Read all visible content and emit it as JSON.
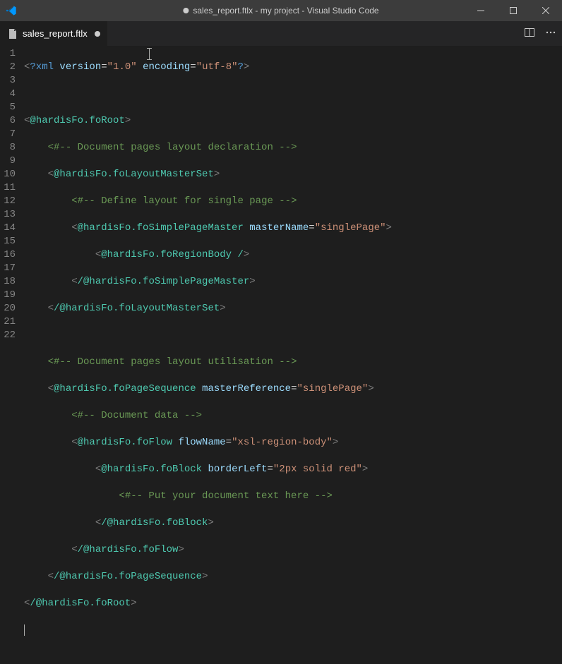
{
  "window": {
    "title": "sales_report.ftlx - my project - Visual Studio Code"
  },
  "tab": {
    "filename": "sales_report.ftlx"
  },
  "lines": {
    "count": 22
  },
  "code": {
    "l1": {
      "xml": "?xml",
      "version_attr": "version",
      "version_val": "\"1.0\"",
      "enc_attr": "encoding",
      "enc_val": "\"utf-8\"",
      "close": "?"
    },
    "l3": {
      "tag": "@hardisFo.foRoot"
    },
    "l4": {
      "comment": "<#-- Document pages layout declaration -->"
    },
    "l5": {
      "tag": "@hardisFo.foLayoutMasterSet"
    },
    "l6": {
      "comment": "<#-- Define layout for single page -->"
    },
    "l7": {
      "tag": "@hardisFo.foSimplePageMaster",
      "attr": "masterName",
      "val": "\"singlePage\""
    },
    "l8": {
      "tag": "@hardisFo.foRegionBody /"
    },
    "l9": {
      "tag": "/@hardisFo.foSimplePageMaster"
    },
    "l10": {
      "tag": "/@hardisFo.foLayoutMasterSet"
    },
    "l12": {
      "comment": "<#-- Document pages layout utilisation -->"
    },
    "l13": {
      "tag": "@hardisFo.foPageSequence",
      "attr": "masterReference",
      "val": "\"singlePage\""
    },
    "l14": {
      "comment": "<#-- Document data -->"
    },
    "l15": {
      "tag": "@hardisFo.foFlow",
      "attr": "flowName",
      "val": "\"xsl-region-body\""
    },
    "l16": {
      "tag": "@hardisFo.foBlock",
      "attr": "borderLeft",
      "val": "\"2px solid red\""
    },
    "l17": {
      "comment": "<#-- Put your document text here -->"
    },
    "l18": {
      "tag": "/@hardisFo.foBlock"
    },
    "l19": {
      "tag": "/@hardisFo.foFlow"
    },
    "l20": {
      "tag": "/@hardisFo.foPageSequence"
    },
    "l21": {
      "tag": "/@hardisFo.foRoot"
    }
  }
}
